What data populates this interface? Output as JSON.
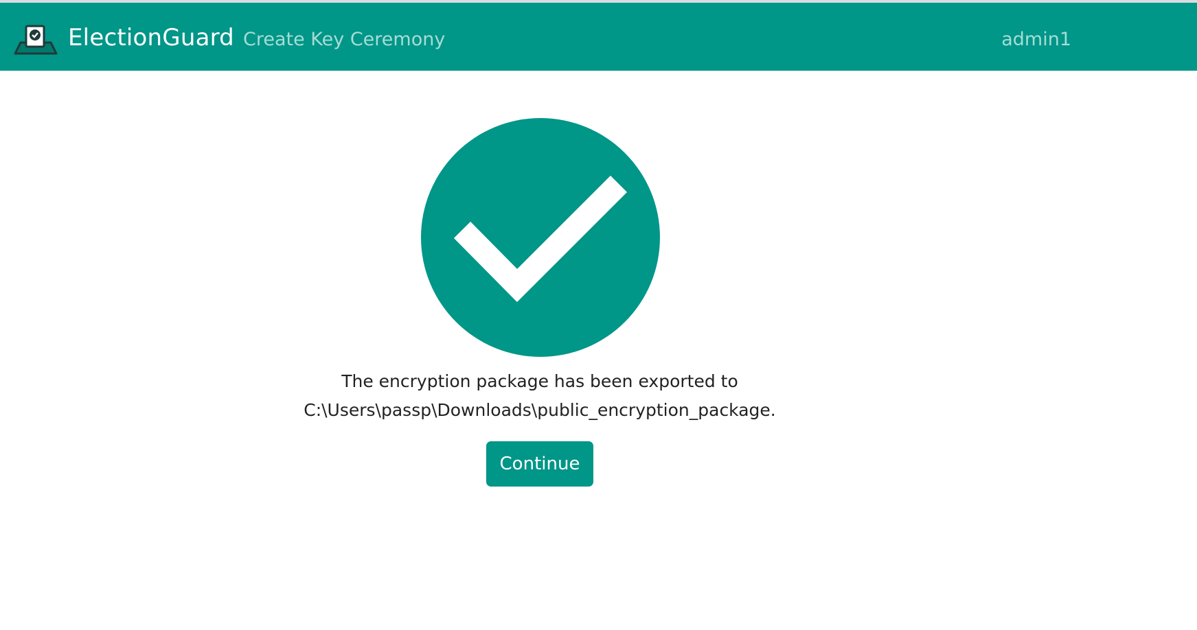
{
  "header": {
    "brand_name": "ElectionGuard",
    "nav_link": "Create Key Ceremony",
    "user_name": "admin1",
    "logo_icon": "ballot-box-check-icon"
  },
  "main": {
    "status_icon": "check-circle-icon",
    "message_line1": "The encryption package has been exported to",
    "message_line2": "C:\\Users\\passp\\Downloads\\public_encryption_package.",
    "continue_label": "Continue"
  },
  "colors": {
    "primary": "#009688",
    "nav_link_text": "#a6ddd6",
    "body_text": "#222222",
    "background": "#ffffff"
  }
}
